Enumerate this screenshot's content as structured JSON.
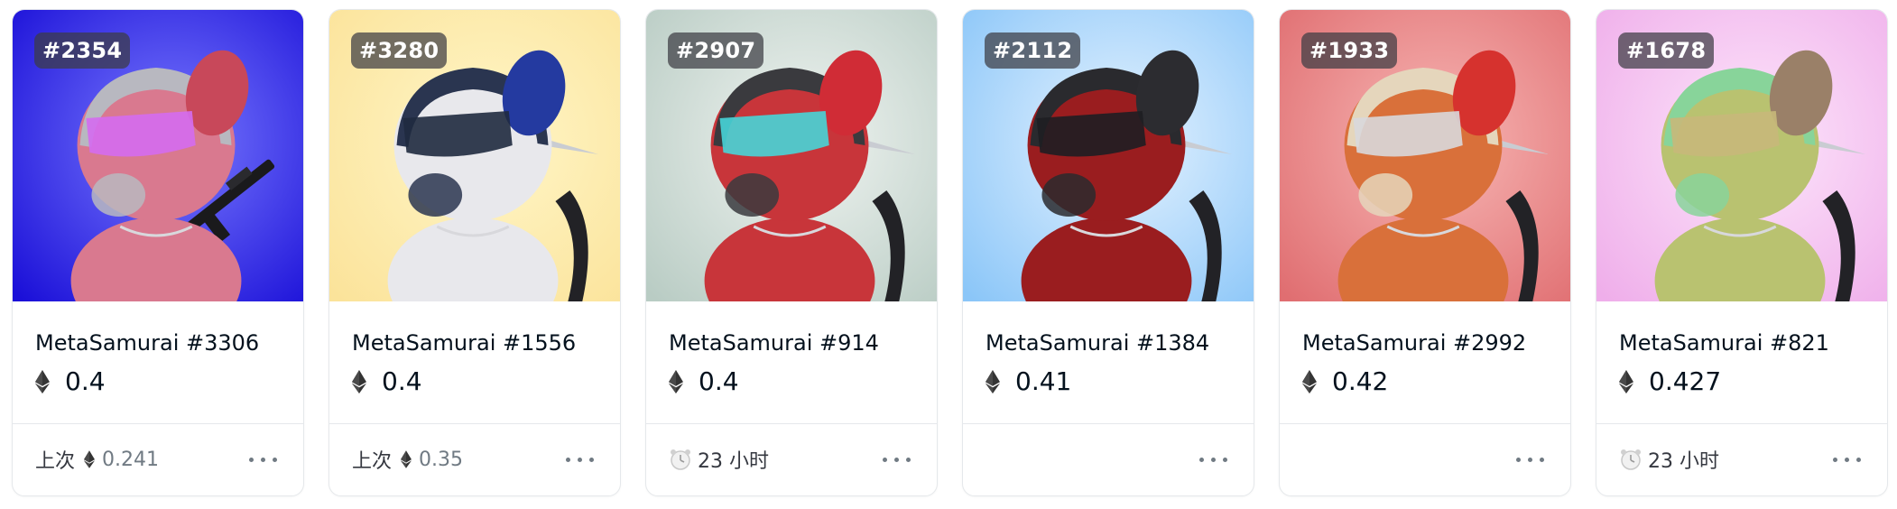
{
  "colors": {
    "border": "#e5e8eb",
    "text_primary": "#04111d",
    "text_secondary": "#707a83"
  },
  "cards": [
    {
      "badge": "#2354",
      "name": "MetaSamurai #3306",
      "price": "0.4",
      "footer_type": "last_sale",
      "footer_label": "上次",
      "footer_value": "0.241",
      "bg_inner": "#7a7bff",
      "bg_outer": "#1b10d8",
      "body_color": "#d9798f",
      "helmet_color": "#b8b8c0",
      "ear_color": "#c8485a",
      "visor_color": "#d46cf0",
      "weapon": "rifle"
    },
    {
      "badge": "#3280",
      "name": "MetaSamurai #1556",
      "price": "0.4",
      "footer_type": "last_sale",
      "footer_label": "上次",
      "footer_value": "0.35",
      "bg_inner": "#fff6c8",
      "bg_outer": "#fbe39a",
      "body_color": "#e8e8ec",
      "helmet_color": "#2a3550",
      "ear_color": "#243aa0",
      "visor_color": "#1f2a3f",
      "weapon": "scythe"
    },
    {
      "badge": "#2907",
      "name": "MetaSamurai #914",
      "price": "0.4",
      "footer_type": "time",
      "footer_value": "23 小时",
      "bg_inner": "#f0f4f1",
      "bg_outer": "#b9ccc4",
      "body_color": "#c8353a",
      "helmet_color": "#3a3a3e",
      "ear_color": "#d02c36",
      "visor_color": "#47d5d8",
      "weapon": "scythe"
    },
    {
      "badge": "#2112",
      "name": "MetaSamurai #1384",
      "price": "0.41",
      "footer_type": "empty",
      "bg_inner": "#e6f3ff",
      "bg_outer": "#8bc6f8",
      "body_color": "#9a1d1f",
      "helmet_color": "#2a2a2e",
      "ear_color": "#2c2c30",
      "visor_color": "#1e1e22",
      "weapon": "scythe"
    },
    {
      "badge": "#1933",
      "name": "MetaSamurai #2992",
      "price": "0.42",
      "footer_type": "empty",
      "bg_inner": "#f7b7b5",
      "bg_outer": "#e06e71",
      "body_color": "#d9703a",
      "helmet_color": "#e5d6bc",
      "ear_color": "#d6322e",
      "visor_color": "#d8d8dc",
      "weapon": "scythe"
    },
    {
      "badge": "#1678",
      "name": "MetaSamurai #821",
      "price": "0.427",
      "footer_type": "time",
      "footer_value": "23 小时",
      "bg_inner": "#fde6fb",
      "bg_outer": "#efaeea",
      "body_color": "#b9c270",
      "helmet_color": "#88d49a",
      "ear_color": "#9a8068",
      "visor_color": "#c8b87a",
      "weapon": "scythe"
    }
  ]
}
